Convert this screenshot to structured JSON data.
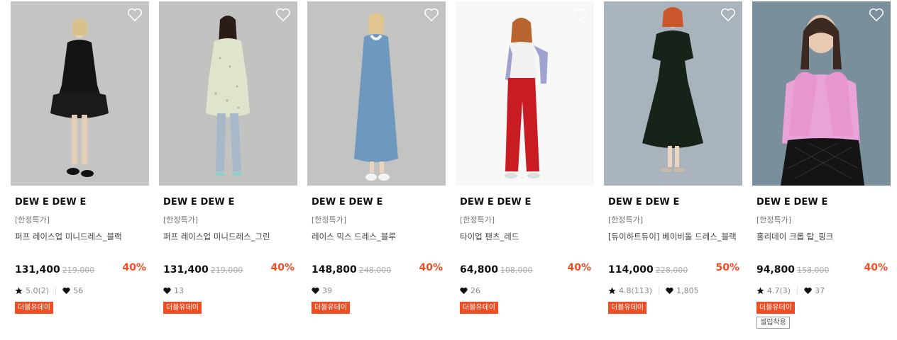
{
  "products": [
    {
      "brand": "DEW E DEW E",
      "tag": "[한정특가]",
      "name": "퍼프 레이스업 미니드레스_블랙",
      "price": "131,400",
      "orig": "219,000",
      "discount": "40%",
      "rating": "5.0(2)",
      "likes": "56",
      "badge": "더블유데이",
      "extra": ""
    },
    {
      "brand": "DEW E DEW E",
      "tag": "[한정특가]",
      "name": "퍼프 레이스업 미니드레스_그린",
      "price": "131,400",
      "orig": "219,000",
      "discount": "40%",
      "rating": "",
      "likes": "13",
      "badge": "더블유데이",
      "extra": ""
    },
    {
      "brand": "DEW E DEW E",
      "tag": "[한정특가]",
      "name": "레이스 믹스 드레스_블루",
      "price": "148,800",
      "orig": "248,000",
      "discount": "40%",
      "rating": "",
      "likes": "39",
      "badge": "더블유데이",
      "extra": ""
    },
    {
      "brand": "DEW E DEW E",
      "tag": "[한정특가]",
      "name": "타이업 팬츠_레드",
      "price": "64,800",
      "orig": "108,000",
      "discount": "40%",
      "rating": "",
      "likes": "26",
      "badge": "더블유데이",
      "extra": ""
    },
    {
      "brand": "DEW E DEW E",
      "tag": "[한정특가]",
      "name": "[듀이하트듀이] 베이비돌 드레스_블랙",
      "price": "114,000",
      "orig": "228,000",
      "discount": "50%",
      "rating": "4.8(113)",
      "likes": "1,805",
      "badge": "더블유데이",
      "extra": ""
    },
    {
      "brand": "DEW E DEW E",
      "tag": "[한정특가]",
      "name": "홀리데이 크롭 탑_핑크",
      "price": "94,800",
      "orig": "158,000",
      "discount": "40%",
      "rating": "4.7(3)",
      "likes": "37",
      "badge": "더블유데이",
      "extra": "셀럽착용"
    }
  ],
  "colors": {
    "accent": "#f04d23"
  },
  "icons": {
    "wish": "heart-outline-icon",
    "star": "star-icon",
    "like": "heart-filled-icon"
  }
}
